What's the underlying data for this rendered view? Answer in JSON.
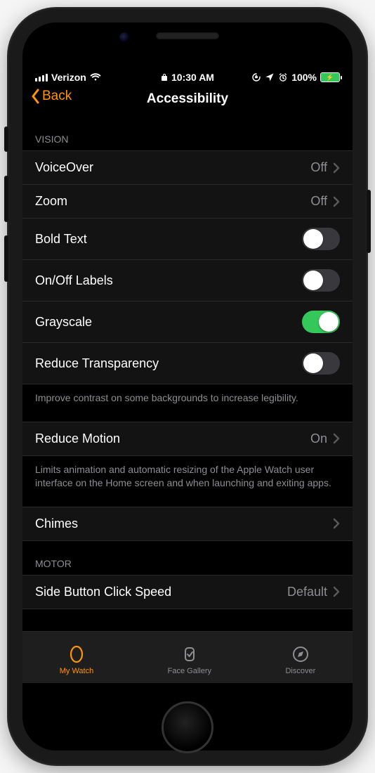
{
  "status": {
    "carrier": "Verizon",
    "time": "10:30 AM",
    "battery": "100%"
  },
  "nav": {
    "back": "Back",
    "title": "Accessibility"
  },
  "sections": {
    "vision_header": "VISION",
    "motor_header": "MOTOR"
  },
  "rows": {
    "voiceover": {
      "label": "VoiceOver",
      "value": "Off"
    },
    "zoom": {
      "label": "Zoom",
      "value": "Off"
    },
    "bold_text": {
      "label": "Bold Text",
      "on": false
    },
    "onoff_labels": {
      "label": "On/Off Labels",
      "on": false
    },
    "grayscale": {
      "label": "Grayscale",
      "on": true
    },
    "reduce_transparency": {
      "label": "Reduce Transparency",
      "on": false
    },
    "reduce_motion": {
      "label": "Reduce Motion",
      "value": "On"
    },
    "chimes": {
      "label": "Chimes"
    },
    "side_button": {
      "label": "Side Button Click Speed",
      "value": "Default"
    }
  },
  "notes": {
    "transparency": "Improve contrast on some backgrounds to increase legibility.",
    "reduce_motion": "Limits animation and automatic resizing of the Apple Watch user interface on the Home screen and when launching and exiting apps."
  },
  "tabs": {
    "mywatch": "My Watch",
    "facegallery": "Face Gallery",
    "discover": "Discover"
  }
}
